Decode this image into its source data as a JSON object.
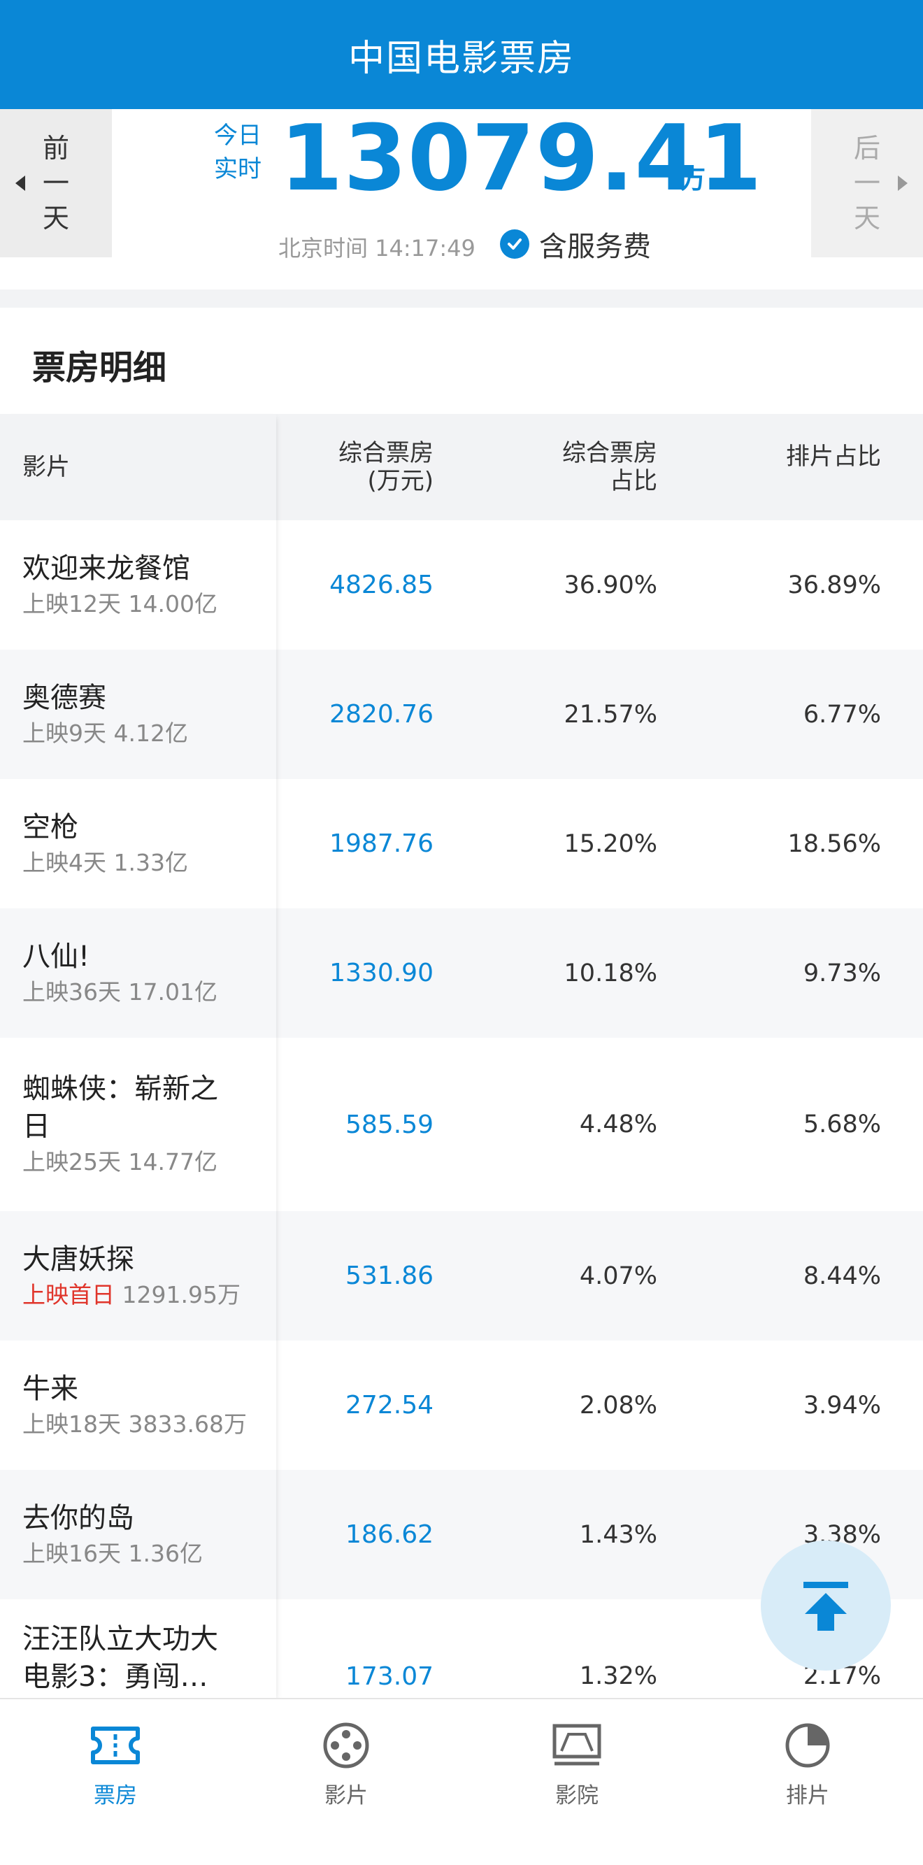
{
  "header": {
    "title": "中国电影票房"
  },
  "summary": {
    "prev_label": [
      "前",
      "一",
      "天"
    ],
    "next_label": [
      "后",
      "一",
      "天"
    ],
    "today_line1": "今日",
    "today_line2": "实时",
    "total": "13079.41",
    "unit": "万",
    "time_label": "北京时间 14:17:49",
    "service_fee": "含服务费"
  },
  "section": {
    "title": "票房明细"
  },
  "table": {
    "headers": {
      "film": "影片",
      "gross_line1": "综合票房",
      "gross_line2": "(万元)",
      "share_line1": "综合票房",
      "share_line2": "占比",
      "screening": "排片占比"
    },
    "rows": [
      {
        "name": "欢迎来龙餐馆",
        "meta": "上映12天 14.00亿",
        "gross": "4826.85",
        "share": "36.90%",
        "screening": "36.89%"
      },
      {
        "name": "奥德赛",
        "meta": "上映9天 4.12亿",
        "gross": "2820.76",
        "share": "21.57%",
        "screening": "6.77%"
      },
      {
        "name": "空枪",
        "meta": "上映4天 1.33亿",
        "gross": "1987.76",
        "share": "15.20%",
        "screening": "18.56%"
      },
      {
        "name": "八仙!",
        "meta": "上映36天 17.01亿",
        "gross": "1330.90",
        "share": "10.18%",
        "screening": "9.73%"
      },
      {
        "name": "蜘蛛侠：崭新之",
        "name2": "日",
        "meta": "上映25天 14.77亿",
        "gross": "585.59",
        "share": "4.48%",
        "screening": "5.68%"
      },
      {
        "name": "大唐妖探",
        "meta_first": "上映首日",
        "meta": "1291.95万",
        "gross": "531.86",
        "share": "4.07%",
        "screening": "8.44%"
      },
      {
        "name": "牛来",
        "meta": "上映18天 3833.68万",
        "gross": "272.54",
        "share": "2.08%",
        "screening": "3.94%"
      },
      {
        "name": "去你的岛",
        "meta": "上映16天 1.36亿",
        "gross": "186.62",
        "share": "1.43%",
        "screening": "3.38%"
      },
      {
        "name": "汪汪队立大功大",
        "name2": "电影3：勇闯…",
        "gross": "173.07",
        "share": "1.32%",
        "screening": "2.17%"
      }
    ]
  },
  "fab": {
    "icon": "scroll-to-top-icon"
  },
  "tabbar": {
    "items": [
      {
        "label": "票房",
        "icon": "ticket-icon",
        "active": true
      },
      {
        "label": "影片",
        "icon": "film-reel-icon"
      },
      {
        "label": "影院",
        "icon": "cinema-screen-icon"
      },
      {
        "label": "排片",
        "icon": "pie-chart-icon"
      }
    ]
  },
  "colors": {
    "brand": "#0a87d6",
    "first_day": "#e0352b"
  }
}
